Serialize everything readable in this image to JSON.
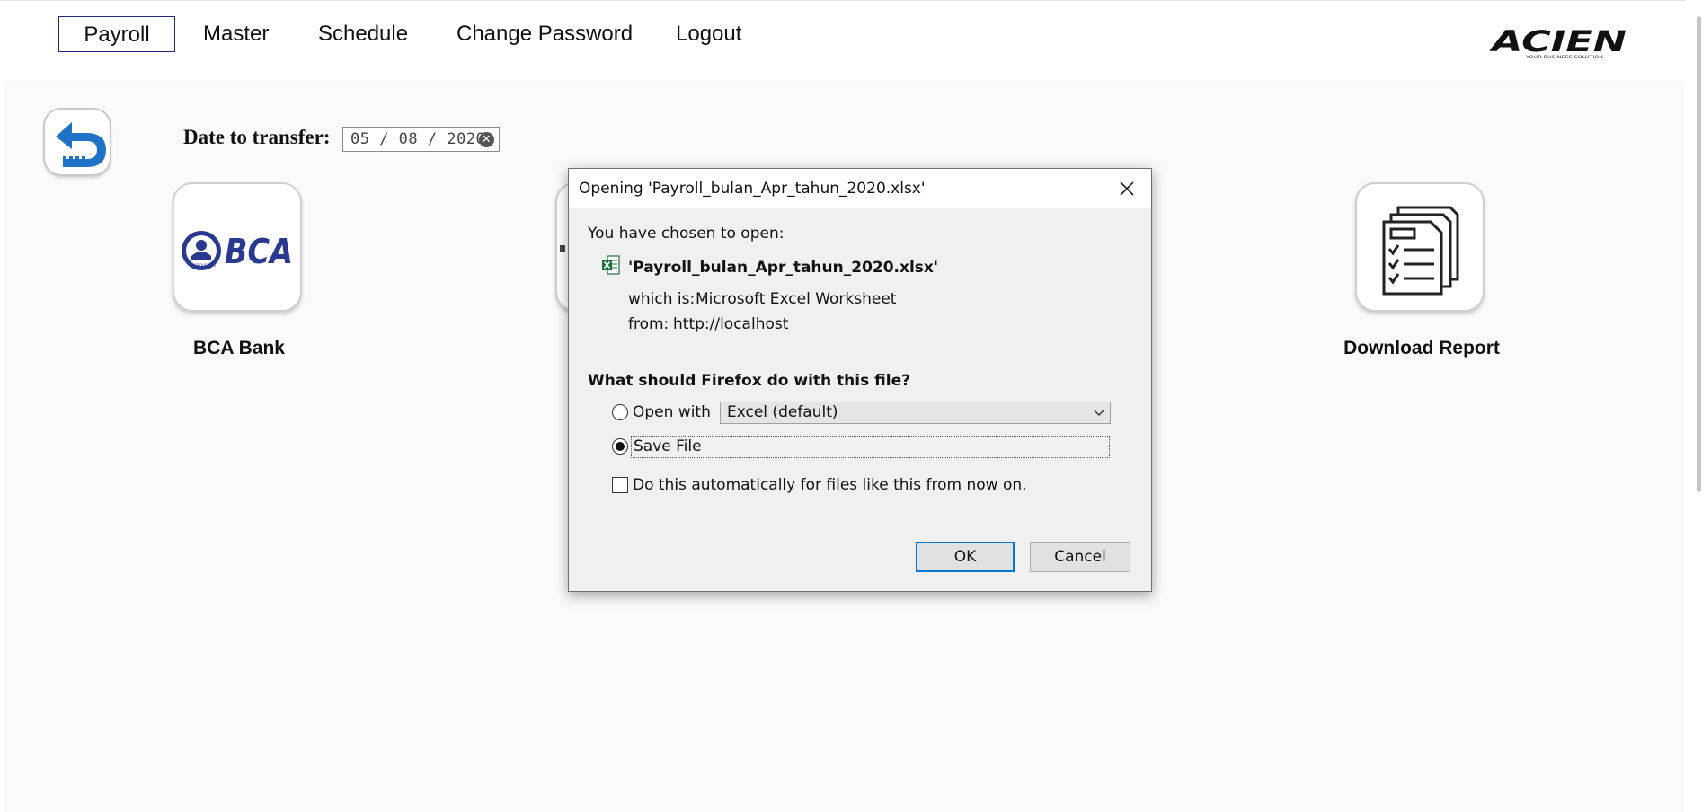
{
  "nav": {
    "items": [
      {
        "label": "Payroll",
        "active": true
      },
      {
        "label": "Master"
      },
      {
        "label": "Schedule"
      },
      {
        "label": "Change Password"
      },
      {
        "label": "Logout"
      }
    ],
    "logo_text": "ACIEN",
    "logo_tagline": "YOUR BUSINESS SOLUTION"
  },
  "page": {
    "date_label": "Date to transfer:",
    "date_value": "05 / 08 / 2020",
    "tiles": [
      {
        "label": "BCA Bank",
        "logo_text": "BCA",
        "logo_sub": "GROUP BCA",
        "icon": "bca-bank-logo"
      },
      {
        "label": "Download Report",
        "icon": "report-document-icon"
      }
    ]
  },
  "dialog": {
    "title": "Opening 'Payroll_bulan_Apr_tahun_2020.xlsx'",
    "chosen_label": "You have chosen to open:",
    "file_name": "'Payroll_bulan_Apr_tahun_2020.xlsx'",
    "which_is_label": "which is:",
    "which_is_value": "Microsoft Excel Worksheet",
    "from_label": "from:",
    "from_value": "http://localhost",
    "question": "What should Firefox do with this file?",
    "open_with_label": "Open with",
    "open_with_value": "Excel (default)",
    "save_file_label": "Save File",
    "selected_option": "save_file",
    "auto_label": "Do this automatically for files like this from now on.",
    "auto_checked": false,
    "ok_label": "OK",
    "cancel_label": "Cancel"
  },
  "colors": {
    "nav_active_border": "#1f2a7a",
    "bca_blue": "#2a3990",
    "back_icon_blue": "#1e73c8",
    "default_button_border": "#0078d7",
    "excel_green": "#1d6f42"
  }
}
